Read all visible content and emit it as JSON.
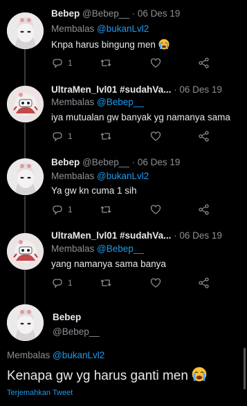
{
  "tweets": [
    {
      "name": "Bebep",
      "handle": "@Bebep__",
      "dot": "·",
      "date": "06 Des 19",
      "reply_prefix": "Membalas",
      "reply_to": "@bukanLvl2",
      "text": "Knpa harus bingung men",
      "reply_count": "1",
      "has_emoji": true
    },
    {
      "name": "UltraMen_lvl01 #sudahVa...",
      "handle": "",
      "dot": "·",
      "date": "06 Des 19",
      "reply_prefix": "Membalas",
      "reply_to": "@Bebep__",
      "text": "iya mutualan gw banyak yg namanya sama",
      "reply_count": "1",
      "has_emoji": false
    },
    {
      "name": "Bebep",
      "handle": "@Bebep__",
      "dot": "·",
      "date": "06 Des 19",
      "reply_prefix": "Membalas",
      "reply_to": "@bukanLvl2",
      "text": "Ya gw kn cuma 1 sih",
      "reply_count": "1",
      "has_emoji": false
    },
    {
      "name": "UltraMen_lvl01 #sudahVa...",
      "handle": "",
      "dot": "·",
      "date": "06 Des 19",
      "reply_prefix": "Membalas",
      "reply_to": "@Bebep__",
      "text": "yang namanya sama banya",
      "reply_count": "1",
      "has_emoji": false
    }
  ],
  "main_tweet": {
    "name": "Bebep",
    "handle": "@Bebep__",
    "reply_prefix": "Membalas",
    "reply_to": "@bukanLvl2",
    "text": "Kenapa gw yg harus ganti men",
    "translate": "Terjemahkan Tweet"
  },
  "colors": {
    "background": "#000000",
    "link": "#1d9bf0",
    "muted": "#8b9096",
    "text": "#e7e9ea"
  },
  "icons": [
    "reply-icon",
    "retweet-icon",
    "like-icon",
    "share-icon",
    "crying-emoji-icon",
    "more-caret-icon"
  ]
}
